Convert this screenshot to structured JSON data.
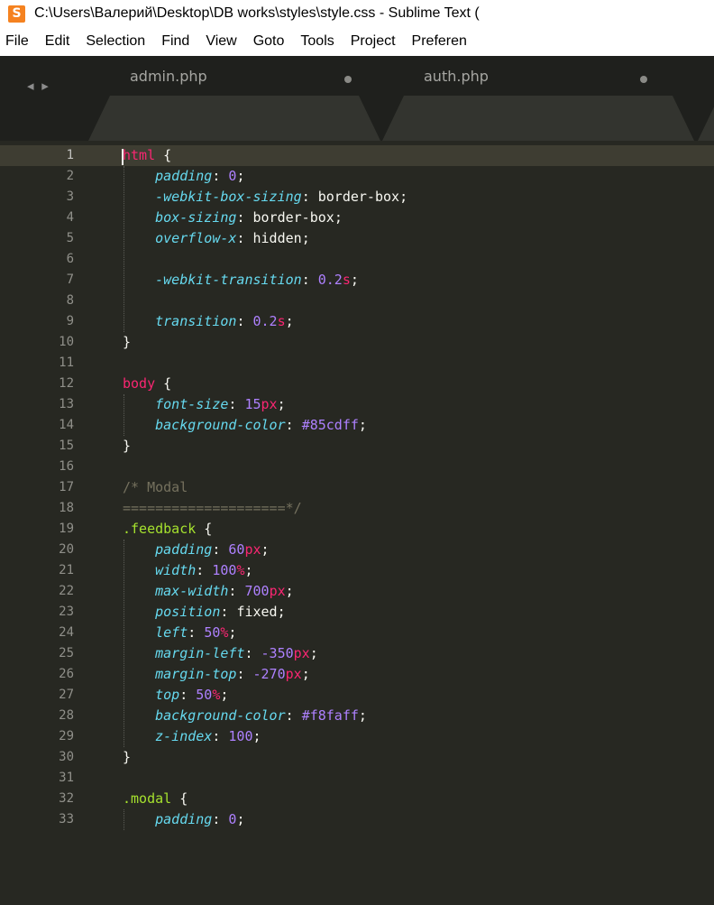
{
  "window": {
    "title": "C:\\Users\\Валерий\\Desktop\\DB works\\styles\\style.css - Sublime Text (",
    "app_icon_glyph": "S",
    "accent": "#f58220"
  },
  "menu": [
    "File",
    "Edit",
    "Selection",
    "Find",
    "View",
    "Goto",
    "Tools",
    "Project",
    "Preferen"
  ],
  "tabs": {
    "nav_arrows": "◂ ▸",
    "items": [
      {
        "label": "admin.php",
        "modified": true
      },
      {
        "label": "auth.php",
        "modified": true
      }
    ]
  },
  "editor": {
    "active_line": 1,
    "lines": [
      [
        {
          "t": "tag",
          "v": "html"
        },
        {
          "t": "punct",
          "v": " {"
        }
      ],
      [
        {
          "t": "pad",
          "v": "    "
        },
        {
          "t": "prop",
          "v": "padding"
        },
        {
          "t": "punct",
          "v": ": "
        },
        {
          "t": "num",
          "v": "0"
        },
        {
          "t": "punct",
          "v": ";"
        }
      ],
      [
        {
          "t": "pad",
          "v": "    "
        },
        {
          "t": "prop",
          "v": "-webkit-box-sizing"
        },
        {
          "t": "punct",
          "v": ": "
        },
        {
          "t": "val",
          "v": "border-box"
        },
        {
          "t": "punct",
          "v": ";"
        }
      ],
      [
        {
          "t": "pad",
          "v": "    "
        },
        {
          "t": "prop",
          "v": "box-sizing"
        },
        {
          "t": "punct",
          "v": ": "
        },
        {
          "t": "val",
          "v": "border-box"
        },
        {
          "t": "punct",
          "v": ";"
        }
      ],
      [
        {
          "t": "pad",
          "v": "    "
        },
        {
          "t": "prop",
          "v": "overflow-x"
        },
        {
          "t": "punct",
          "v": ": "
        },
        {
          "t": "val",
          "v": "hidden"
        },
        {
          "t": "punct",
          "v": ";"
        }
      ],
      [],
      [
        {
          "t": "pad",
          "v": "    "
        },
        {
          "t": "prop",
          "v": "-webkit-transition"
        },
        {
          "t": "punct",
          "v": ": "
        },
        {
          "t": "num",
          "v": "0.2"
        },
        {
          "t": "unit",
          "v": "s"
        },
        {
          "t": "punct",
          "v": ";"
        }
      ],
      [],
      [
        {
          "t": "pad",
          "v": "    "
        },
        {
          "t": "prop",
          "v": "transition"
        },
        {
          "t": "punct",
          "v": ": "
        },
        {
          "t": "num",
          "v": "0.2"
        },
        {
          "t": "unit",
          "v": "s"
        },
        {
          "t": "punct",
          "v": ";"
        }
      ],
      [
        {
          "t": "punct",
          "v": "}"
        }
      ],
      [],
      [
        {
          "t": "tag",
          "v": "body"
        },
        {
          "t": "punct",
          "v": " {"
        }
      ],
      [
        {
          "t": "pad",
          "v": "    "
        },
        {
          "t": "prop",
          "v": "font-size"
        },
        {
          "t": "punct",
          "v": ": "
        },
        {
          "t": "num",
          "v": "15"
        },
        {
          "t": "unit",
          "v": "px"
        },
        {
          "t": "punct",
          "v": ";"
        }
      ],
      [
        {
          "t": "pad",
          "v": "    "
        },
        {
          "t": "prop",
          "v": "background-color"
        },
        {
          "t": "punct",
          "v": ": "
        },
        {
          "t": "num",
          "v": "#85cdff"
        },
        {
          "t": "punct",
          "v": ";"
        }
      ],
      [
        {
          "t": "punct",
          "v": "}"
        }
      ],
      [],
      [
        {
          "t": "comment",
          "v": "/* Modal"
        }
      ],
      [
        {
          "t": "comment",
          "v": "====================*/"
        }
      ],
      [
        {
          "t": "class",
          "v": ".feedback"
        },
        {
          "t": "punct",
          "v": " {"
        }
      ],
      [
        {
          "t": "pad",
          "v": "    "
        },
        {
          "t": "prop",
          "v": "padding"
        },
        {
          "t": "punct",
          "v": ": "
        },
        {
          "t": "num",
          "v": "60"
        },
        {
          "t": "unit",
          "v": "px"
        },
        {
          "t": "punct",
          "v": ";"
        }
      ],
      [
        {
          "t": "pad",
          "v": "    "
        },
        {
          "t": "prop",
          "v": "width"
        },
        {
          "t": "punct",
          "v": ": "
        },
        {
          "t": "num",
          "v": "100"
        },
        {
          "t": "unit",
          "v": "%"
        },
        {
          "t": "punct",
          "v": ";"
        }
      ],
      [
        {
          "t": "pad",
          "v": "    "
        },
        {
          "t": "prop",
          "v": "max-width"
        },
        {
          "t": "punct",
          "v": ": "
        },
        {
          "t": "num",
          "v": "700"
        },
        {
          "t": "unit",
          "v": "px"
        },
        {
          "t": "punct",
          "v": ";"
        }
      ],
      [
        {
          "t": "pad",
          "v": "    "
        },
        {
          "t": "prop",
          "v": "position"
        },
        {
          "t": "punct",
          "v": ": "
        },
        {
          "t": "val",
          "v": "fixed"
        },
        {
          "t": "punct",
          "v": ";"
        }
      ],
      [
        {
          "t": "pad",
          "v": "    "
        },
        {
          "t": "prop",
          "v": "left"
        },
        {
          "t": "punct",
          "v": ": "
        },
        {
          "t": "num",
          "v": "50"
        },
        {
          "t": "unit",
          "v": "%"
        },
        {
          "t": "punct",
          "v": ";"
        }
      ],
      [
        {
          "t": "pad",
          "v": "    "
        },
        {
          "t": "prop",
          "v": "margin-left"
        },
        {
          "t": "punct",
          "v": ": "
        },
        {
          "t": "num",
          "v": "-350"
        },
        {
          "t": "unit",
          "v": "px"
        },
        {
          "t": "punct",
          "v": ";"
        }
      ],
      [
        {
          "t": "pad",
          "v": "    "
        },
        {
          "t": "prop",
          "v": "margin-top"
        },
        {
          "t": "punct",
          "v": ": "
        },
        {
          "t": "num",
          "v": "-270"
        },
        {
          "t": "unit",
          "v": "px"
        },
        {
          "t": "punct",
          "v": ";"
        }
      ],
      [
        {
          "t": "pad",
          "v": "    "
        },
        {
          "t": "prop",
          "v": "top"
        },
        {
          "t": "punct",
          "v": ": "
        },
        {
          "t": "num",
          "v": "50"
        },
        {
          "t": "unit",
          "v": "%"
        },
        {
          "t": "punct",
          "v": ";"
        }
      ],
      [
        {
          "t": "pad",
          "v": "    "
        },
        {
          "t": "prop",
          "v": "background-color"
        },
        {
          "t": "punct",
          "v": ": "
        },
        {
          "t": "num",
          "v": "#f8faff"
        },
        {
          "t": "punct",
          "v": ";"
        }
      ],
      [
        {
          "t": "pad",
          "v": "    "
        },
        {
          "t": "prop",
          "v": "z-index"
        },
        {
          "t": "punct",
          "v": ": "
        },
        {
          "t": "num",
          "v": "100"
        },
        {
          "t": "punct",
          "v": ";"
        }
      ],
      [
        {
          "t": "punct",
          "v": "}"
        }
      ],
      [],
      [
        {
          "t": "class",
          "v": ".modal"
        },
        {
          "t": "punct",
          "v": " {"
        }
      ],
      [
        {
          "t": "pad",
          "v": "    "
        },
        {
          "t": "prop",
          "v": "padding"
        },
        {
          "t": "punct",
          "v": ": "
        },
        {
          "t": "num",
          "v": "0"
        },
        {
          "t": "punct",
          "v": ";"
        }
      ]
    ]
  }
}
